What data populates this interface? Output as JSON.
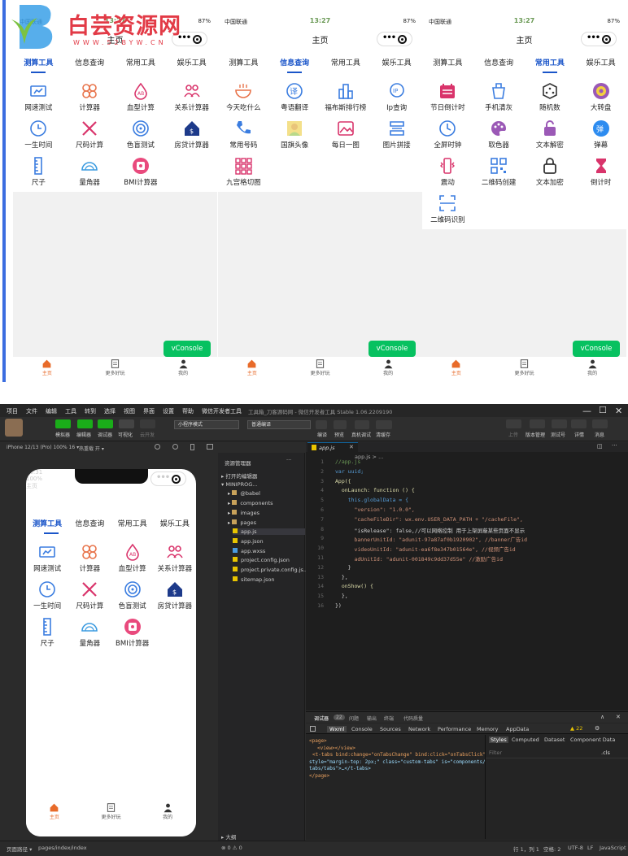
{
  "watermark": {
    "title": "白芸资源网",
    "url": "WWW.52BYW.CN"
  },
  "status": {
    "carrier": "中国联通",
    "time": "13:27",
    "battery": "87%"
  },
  "page_title": "主页",
  "tabs": [
    "测算工具",
    "信息查询",
    "常用工具",
    "娱乐工具"
  ],
  "phone1": {
    "active_tab": 0,
    "items": [
      "网速测试",
      "计算器",
      "血型计算",
      "关系计算器",
      "一生时间",
      "尺码计算",
      "色盲测试",
      "房贷计算器",
      "尺子",
      "量角器",
      "BMI计算器"
    ]
  },
  "phone2": {
    "active_tab": 1,
    "items": [
      "今天吃什么",
      "粤语翻译",
      "福布斯排行榜",
      "Ip查询",
      "常用号码",
      "国旗头像",
      "每日一图",
      "图片拼接",
      "九宫格切图"
    ]
  },
  "phone3": {
    "active_tab": 2,
    "items": [
      "节日倒计时",
      "手机清灰",
      "随机数",
      "大转盘",
      "全屏时钟",
      "取色器",
      "文本解密",
      "弹幕",
      "震动",
      "二维码创建",
      "文本加密",
      "倒计时",
      "二维码识别"
    ]
  },
  "vconsole_label": "vConsole",
  "tabbar": [
    "主页",
    "更多好玩",
    "我的"
  ],
  "colors": {
    "accent": "#1a55c9",
    "vconsole": "#07c160",
    "tab_active": "#e86b2a"
  },
  "ide": {
    "menu": [
      "项目",
      "文件",
      "编辑",
      "工具",
      "转到",
      "选择",
      "视图",
      "界面",
      "设置",
      "帮助",
      "微信开发者工具"
    ],
    "window_title": "工具箱_刀客源码网 - 微信开发者工具 Stable 1.06.2209190",
    "toolbar_left": [
      "模拟器",
      "编辑器",
      "调试器",
      "可视化",
      "云开发"
    ],
    "mode_select": "小程序模式",
    "compile_select": "普通编译",
    "toolbar_mid": [
      "编译",
      "预览",
      "真机调试",
      "清缓存"
    ],
    "toolbar_right": [
      "上传",
      "版本管理",
      "测试号",
      "详情",
      "消息"
    ],
    "device": "iPhone 12/13 (Pro) 100% 16 ▾",
    "hotreload": "热重载 开 ▾",
    "sim_time": "19:31",
    "sim_battery": "100%",
    "explorer_title": "资源管理器",
    "explorer_items": [
      "打开的编辑器",
      "MINIPROG...",
      "@babel",
      "components",
      "images",
      "pages",
      "app.js",
      "app.json",
      "app.wxss",
      "project.config.json",
      "project.private.config.js...",
      "sitemap.json"
    ],
    "outline": "大纲",
    "tab_file": "app.js",
    "breadcrumb": "app.js > ...",
    "code_lines": [
      "//app.js",
      "var uuid;",
      "App({",
      "  onLaunch: function () {",
      "    this.globalData = {",
      "      \"version\": \"1.0.0\",",
      "      \"cacheFileDir\": wx.env.USER_DATA_PATH + \"/cacheFile\",",
      "      \"isRelease\": false,//可以网络控制 用于上架屏蔽某些页面不显示",
      "      bannerUnitId: \"adunit-97a87af0b1920902\", //banner广告id",
      "      videoUnitId: \"adunit-ea6f8e347b01564e\", //视频广告id",
      "      adUnitId: \"adunit-001849c9dd37d55e\" //激励广告id",
      "    }",
      "  },",
      "  onShow() {",
      "  },",
      "})"
    ],
    "debug_tabs": [
      "调试器",
      "22",
      "问题",
      "输出",
      "终端",
      "代码质量"
    ],
    "devtools_tabs": [
      "Wxml",
      "Console",
      "Sources",
      "Network",
      "Performance",
      "Memory",
      "AppData"
    ],
    "warn_count": "22",
    "style_tabs": [
      "Styles",
      "Computed",
      "Dataset",
      "Component Data"
    ],
    "filter_placeholder": "Filter",
    "cls": ".cls",
    "wxml": [
      "<page>",
      "<view></view>",
      "<t-tabs bind:change=\"onTabsChange\" bind:click=\"onTabsClick\"",
      "style=\"margin-top: 2px;\" class=\"custom-tabs\" is=\"components/",
      "tabs/tabs\">…</t-tabs>",
      "</page>"
    ],
    "status_left": "页面路径 ▾",
    "status_path": "pages/index/index",
    "status_errors": "⊗ 0 ⚠ 0",
    "status_right": [
      "行 1，列 1",
      "空格: 2",
      "UTF-8",
      "LF",
      "JavaScript"
    ]
  }
}
